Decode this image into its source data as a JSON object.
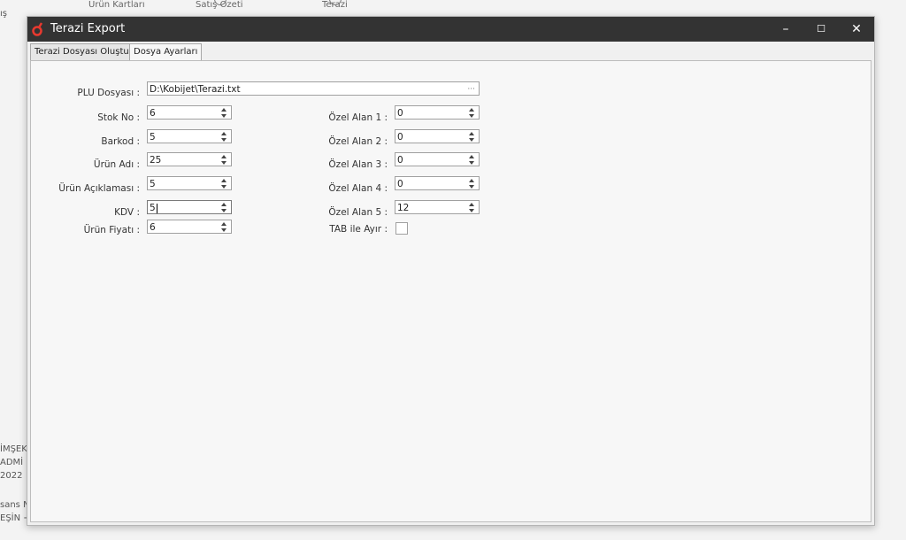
{
  "background_app": {
    "nav": [
      {
        "label": "Ürün Kartları",
        "icon": "heart-icon"
      },
      {
        "label": "Satış Özeti",
        "icon": "chart-icon"
      },
      {
        "label": "Terazi",
        "icon": "scale-icon"
      }
    ],
    "left_fragments": [
      "ış",
      "İMŞEK",
      "ADMİ",
      "2022",
      "sans N",
      "EŞİN +"
    ]
  },
  "window": {
    "title": "Terazi Export",
    "accent": "#e8392f",
    "titlebar_color": "#333333",
    "controls": {
      "minimize": "–",
      "maximize": "☐",
      "close": "✕"
    }
  },
  "tabs": [
    {
      "label": "Terazi Dosyası Oluştur",
      "active": false
    },
    {
      "label": "Dosya Ayarları",
      "active": true
    }
  ],
  "form": {
    "plu": {
      "label": "PLU Dosyası :",
      "value": "D:\\Kobijet\\Terazi.txt",
      "button": "···"
    },
    "left": [
      {
        "label": "Stok No :",
        "value": "6"
      },
      {
        "label": "Barkod :",
        "value": "5"
      },
      {
        "label": "Ürün Adı :",
        "value": "25"
      },
      {
        "label": "Ürün Açıklaması :",
        "value": "5"
      },
      {
        "label": "KDV :",
        "value": "5"
      },
      {
        "label": "Ürün Fiyatı :",
        "value": "6"
      }
    ],
    "right": [
      {
        "label": "Özel Alan 1 :",
        "value": "0"
      },
      {
        "label": "Özel Alan 2 :",
        "value": "0"
      },
      {
        "label": "Özel Alan 3 :",
        "value": "0"
      },
      {
        "label": "Özel Alan 4 :",
        "value": "0"
      },
      {
        "label": "Özel Alan 5 :",
        "value": "12"
      }
    ],
    "tab_separator": {
      "label": "TAB ile Ayır :",
      "checked": false
    }
  }
}
